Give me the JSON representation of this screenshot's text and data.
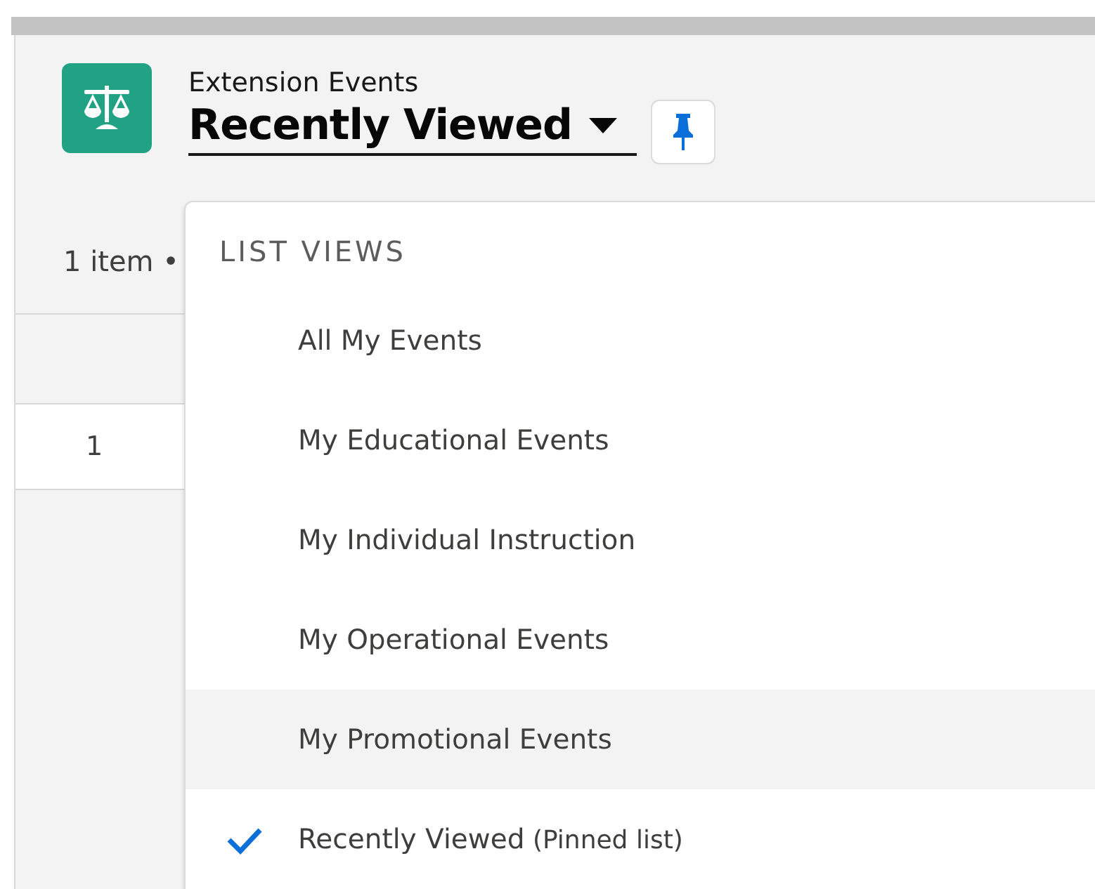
{
  "header": {
    "object_name": "Extension Events",
    "list_view": "Recently Viewed"
  },
  "summary": "1 item •",
  "table": {
    "rows": [
      {
        "number": "1"
      }
    ]
  },
  "dropdown": {
    "heading": "LIST VIEWS",
    "items": [
      {
        "label": "All My Events",
        "highlighted": false,
        "selected": false
      },
      {
        "label": "My Educational Events",
        "highlighted": false,
        "selected": false
      },
      {
        "label": "My Individual Instruction",
        "highlighted": false,
        "selected": false
      },
      {
        "label": "My Operational Events",
        "highlighted": false,
        "selected": false
      },
      {
        "label": "My Promotional Events",
        "highlighted": true,
        "selected": false
      },
      {
        "label": "Recently Viewed",
        "note": "(Pinned list)",
        "highlighted": false,
        "selected": true
      }
    ]
  }
}
